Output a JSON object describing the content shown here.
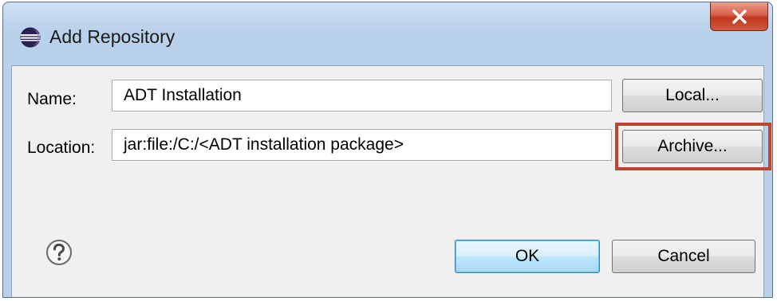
{
  "dialog": {
    "title": "Add Repository",
    "close_icon": "close-x-icon",
    "app_icon": "eclipse-icon"
  },
  "form": {
    "name_label": "Name:",
    "name_value": "ADT Installation",
    "location_label": "Location:",
    "location_value": "jar:file:/C:/<ADT installation package>"
  },
  "buttons": {
    "local": "Local...",
    "archive": "Archive...",
    "ok": "OK",
    "cancel": "Cancel"
  },
  "help_icon": "question-mark-icon",
  "colors": {
    "highlight": "#c0442f",
    "close_button": "#c1381f",
    "titlebar": "#b9d1ea"
  }
}
